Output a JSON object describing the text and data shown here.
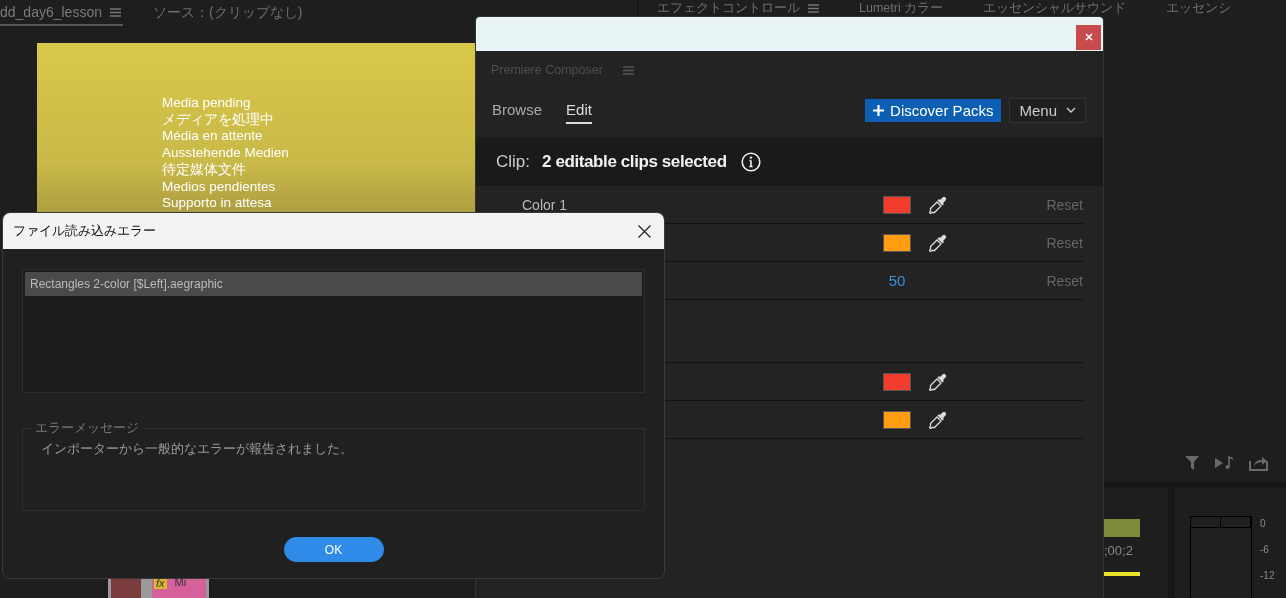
{
  "background_tabs": [
    {
      "label": "dd_day6_lesson",
      "selected": true,
      "menu": true
    },
    {
      "label": "ソース：(クリップなし)",
      "selected": false,
      "menu": false
    }
  ],
  "panel_tabs": [
    {
      "label": "エフェクトコントロール",
      "menu": true
    },
    {
      "label": "Lumetri カラー",
      "menu": false
    },
    {
      "label": "エッセンシャルサウンド",
      "menu": false
    },
    {
      "label": "エッセンシ",
      "menu": false
    }
  ],
  "monitor": {
    "messages": [
      "Media pending",
      "メディアを処理中",
      "Média en attente",
      "Ausstehende Medien",
      "待定媒体文件",
      "Medios pendientes",
      "Supporto in attesa"
    ]
  },
  "timeline": {
    "timecode": ";00;2",
    "clip_badge": "fx",
    "clip_label": "Mi"
  },
  "audio_meter": {
    "scale": [
      "0",
      "-6",
      "-12"
    ]
  },
  "composer": {
    "panel_title": "Premiere Composer",
    "tabs": [
      {
        "label": "Browse",
        "selected": false
      },
      {
        "label": "Edit",
        "selected": true
      }
    ],
    "discover_button": "Discover Packs",
    "menu_button": "Menu",
    "clip_label": "Clip:",
    "clip_summary": "2 editable clips selected",
    "properties": [
      {
        "kind": "color",
        "label": "Color 1",
        "color": "#f23c2e",
        "reset": "Reset"
      },
      {
        "kind": "color",
        "color": "#ff9c12",
        "reset": "Reset"
      },
      {
        "kind": "number",
        "value": "50",
        "reset": "Reset"
      },
      {
        "kind": "spacer"
      },
      {
        "kind": "color",
        "color": "#f23c2e"
      },
      {
        "kind": "color",
        "color": "#ff9c12"
      }
    ]
  },
  "dialog": {
    "title": "ファイル読み込みエラー",
    "files": [
      {
        "name": "Rectangles 2-color [$Left].aegraphic",
        "selected": true
      }
    ],
    "message_group": "エラーメッセージ",
    "message": "インポーターから一般的なエラーが報告されました。",
    "ok_button": "OK"
  }
}
